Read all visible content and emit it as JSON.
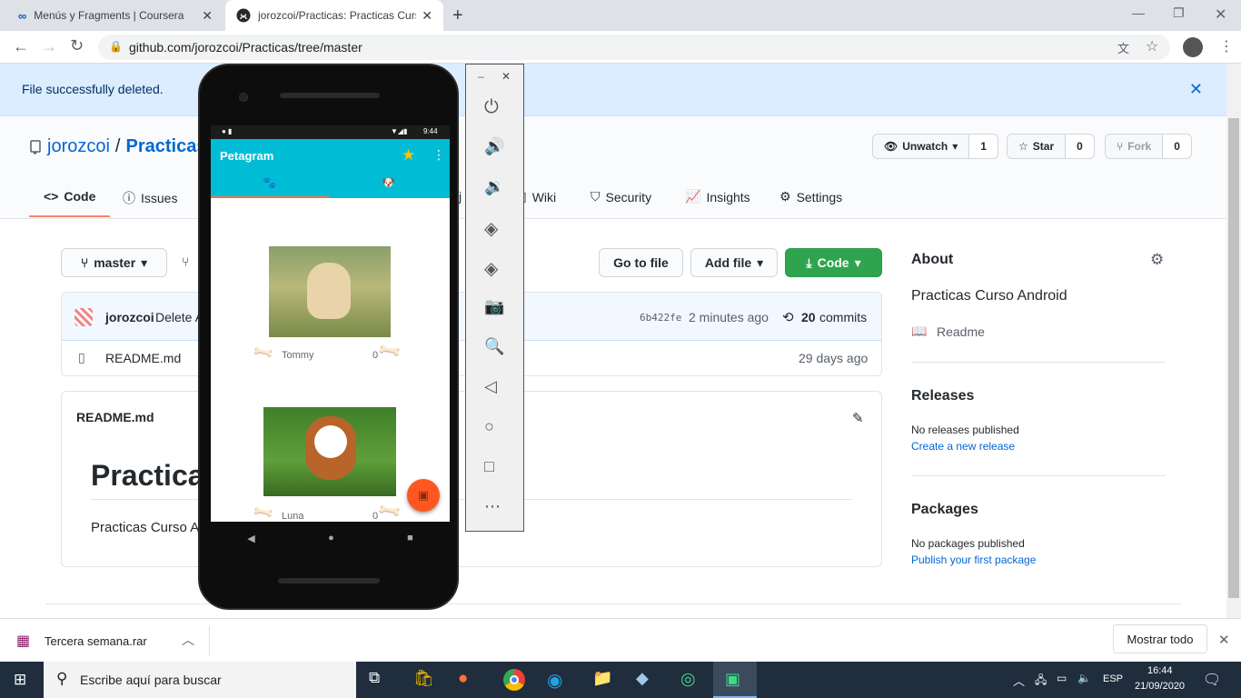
{
  "browser": {
    "tabs": [
      {
        "title": "Menús y Fragments | Coursera"
      },
      {
        "title": "jorozcoi/Practicas: Practicas Curs"
      }
    ],
    "url": "github.com/jorozcoi/Practicas/tree/master"
  },
  "flash": {
    "message": "File successfully deleted."
  },
  "repo": {
    "owner": "jorozcoi",
    "sep": "/",
    "name": "Practicas",
    "unwatch_label": "Unwatch",
    "watch_count": "1",
    "star_label": "Star",
    "star_count": "0",
    "fork_label": "Fork",
    "fork_count": "0"
  },
  "nav": {
    "code": "Code",
    "issues": "Issues",
    "wiki_partial": "Wiki",
    "wiki_prefix": "j",
    "security": "Security",
    "insights": "Insights",
    "settings": "Settings"
  },
  "toolbar": {
    "branch": "master",
    "goto_file": "Go to file",
    "add_file": "Add file",
    "code_btn": "Code"
  },
  "commit": {
    "author": "jorozcoi",
    "message": "Delete A",
    "sha": "6b422fe",
    "time": "2 minutes ago",
    "count": "20",
    "commits_label": "commits"
  },
  "files": [
    {
      "name": "README.md",
      "time": "29 days ago"
    }
  ],
  "readme": {
    "header": "README.md",
    "title": "Practicas",
    "body": "Practicas Curso A"
  },
  "about": {
    "heading": "About",
    "description": "Practicas Curso Android",
    "readme": "Readme"
  },
  "releases": {
    "heading": "Releases",
    "none": "No releases published",
    "link": "Create a new release"
  },
  "packages": {
    "heading": "Packages",
    "none": "No packages published",
    "link": "Publish your first package"
  },
  "emulator": {
    "time": "9:44",
    "app_title": "Petagram",
    "pets": [
      {
        "name": "Tommy",
        "likes": "0"
      },
      {
        "name": "Luna",
        "likes": "0"
      }
    ]
  },
  "downloads": {
    "file": "Tercera semana.rar",
    "show_all": "Mostrar todo"
  },
  "taskbar": {
    "search_placeholder": "Escribe aquí para buscar",
    "lang": "ESP",
    "time": "16:44",
    "date": "21/09/2020"
  },
  "colors": {
    "github_blue": "#0366d6",
    "green_btn": "#2ea44f",
    "flash_bg": "#dbedff",
    "app_cyan": "#00bcd4",
    "fab": "#ff5722",
    "taskbar": "#1f2d3d"
  }
}
